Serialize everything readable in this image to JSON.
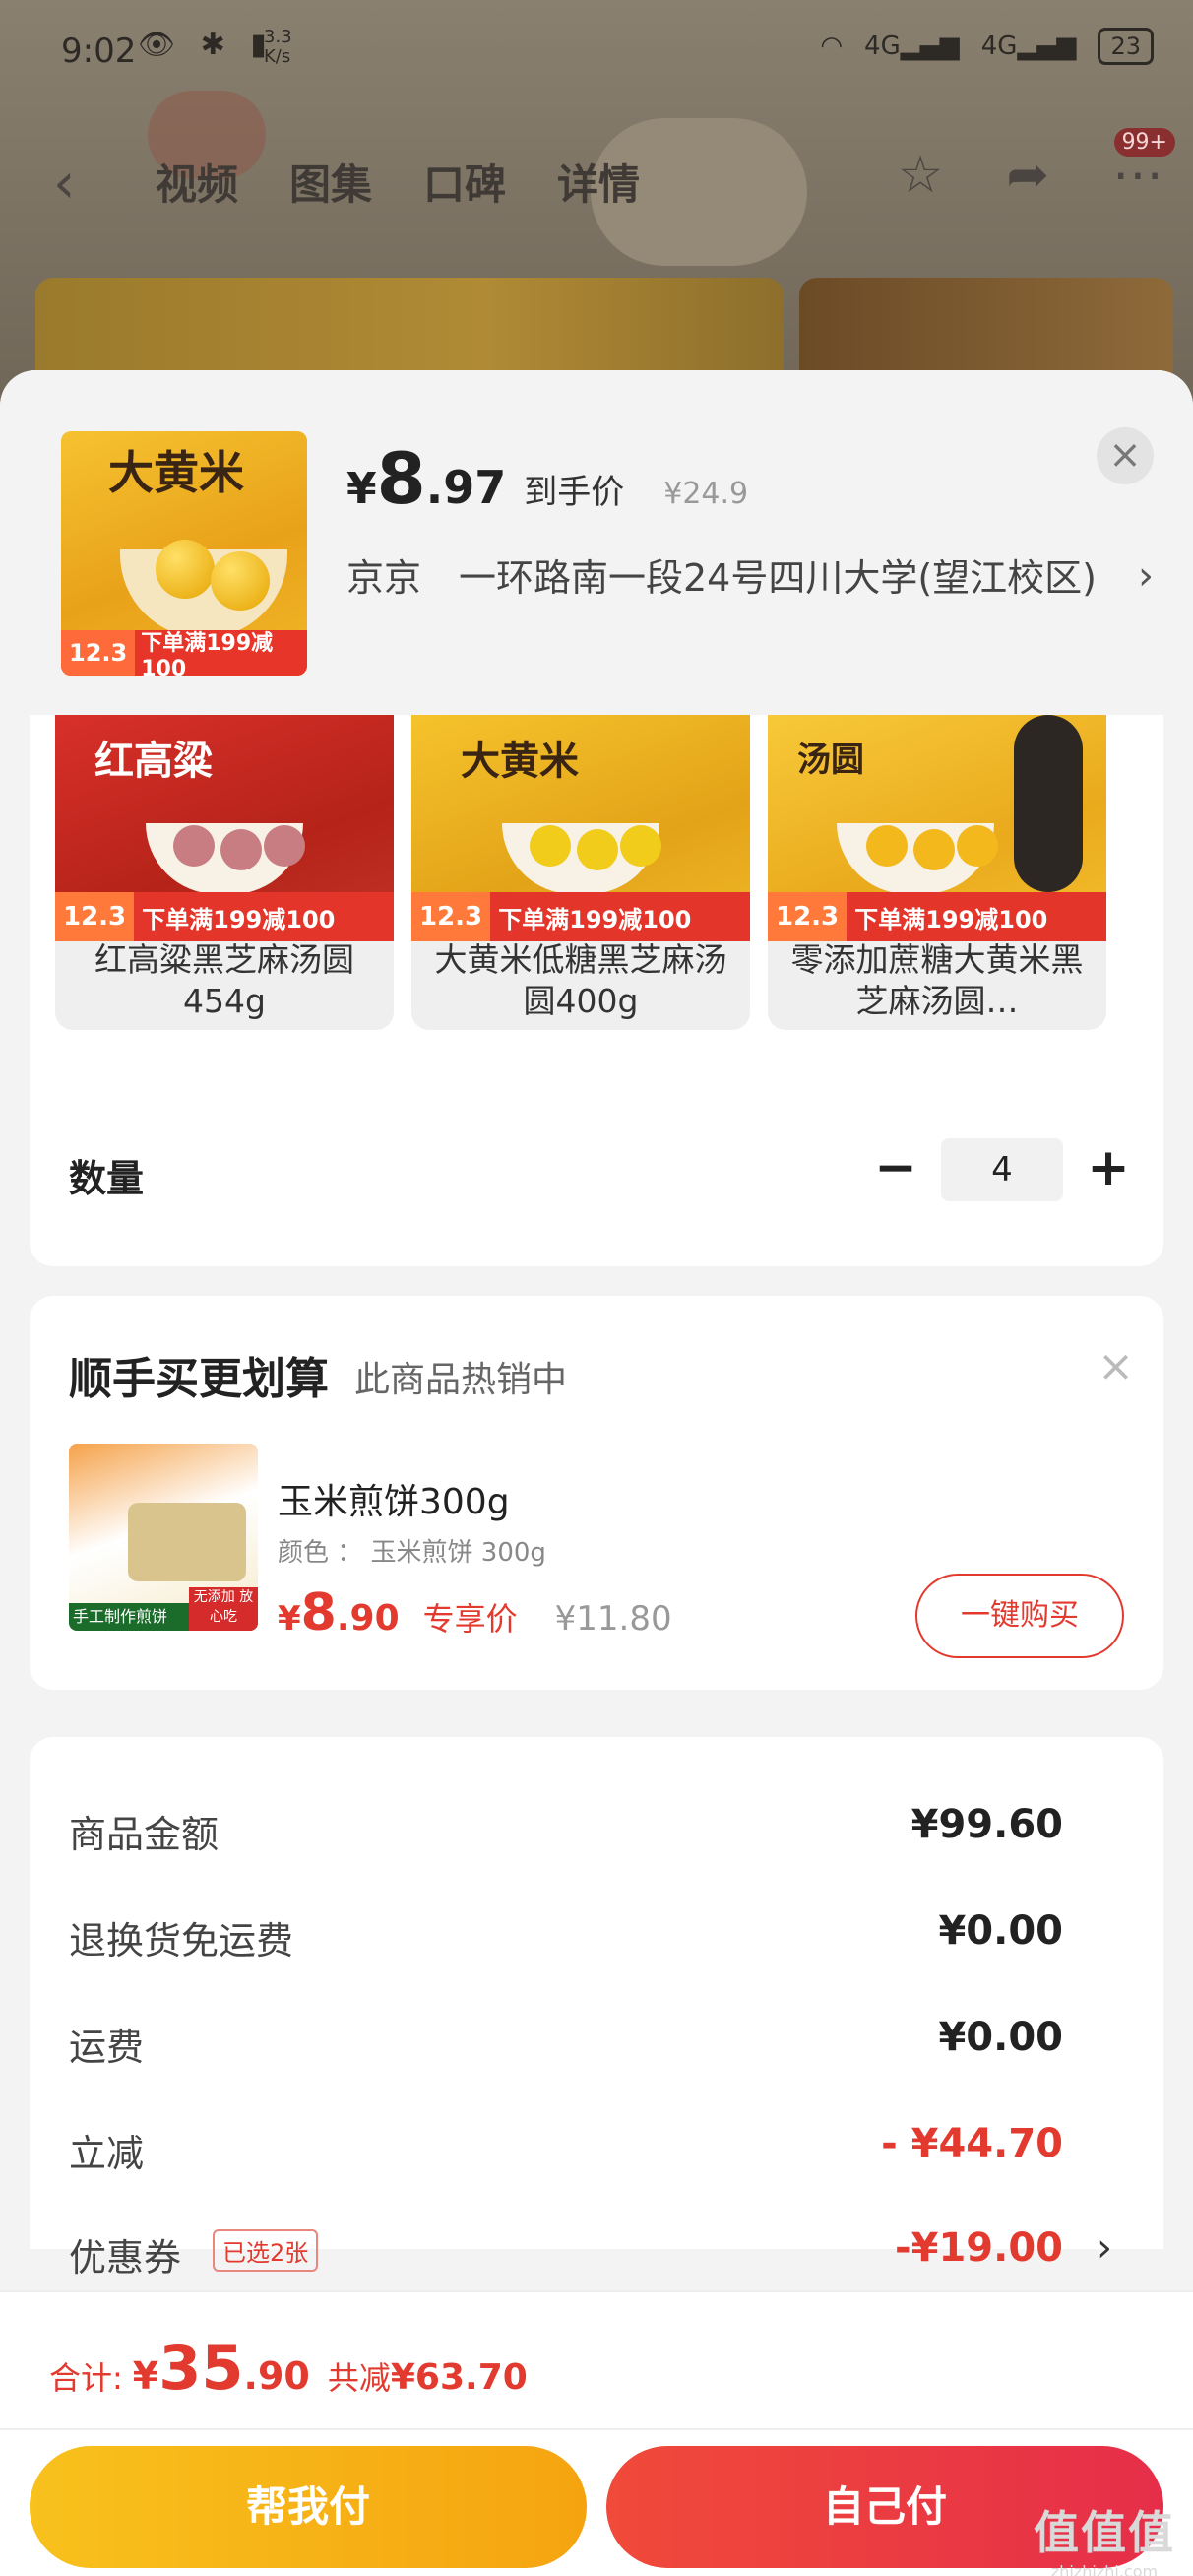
{
  "status_bar": {
    "time": "9:02",
    "speed": "3.3\nK/s",
    "battery": "23",
    "network1": "4G",
    "network2": "4G"
  },
  "top_nav": {
    "tabs": [
      "视频",
      "图集",
      "口碑",
      "详情"
    ],
    "badge": "99+"
  },
  "product": {
    "price_currency": "¥",
    "price_int": "8",
    "price_dec": ".97",
    "price_label": "到手价",
    "original_price": "¥24.9",
    "address": "京京　一环路南一段24号四川大学(望江校区)",
    "thumb_title": "大黄米",
    "thumb_price": "12.3",
    "thumb_promo": "下单满199减100"
  },
  "variants": [
    {
      "label": "红高粱黑芝麻汤圆454g",
      "title": "红高粱",
      "promo_price": "12.3",
      "promo_text": "下单满199减100"
    },
    {
      "label": "大黄米低糖黑芝麻汤圆400g",
      "title": "大黄米",
      "promo_price": "12.3",
      "promo_text": "下单满199减100"
    },
    {
      "label": "零添加蔗糖大黄米黑芝麻汤圆…",
      "title": "汤圆",
      "promo_price": "12.3",
      "promo_text": "下单满199减100"
    }
  ],
  "quantity": {
    "label": "数量",
    "minus": "−",
    "value": "4",
    "plus": "+"
  },
  "addon": {
    "title": "顺手买更划算",
    "subtitle": "此商品热销中",
    "close": "×",
    "name": "玉米煎饼300g",
    "color_line": "颜色 ： 玉米煎饼 300g",
    "price_currency": "¥",
    "price_int": "8",
    "price_dec": ".90",
    "price_tag": "专享价",
    "old_price": "¥11.80",
    "buy_button": "一键购买",
    "img_strip": "手工制作煎饼",
    "img_strip2": "无添加 放心吃"
  },
  "fees": {
    "goods_label": "商品金额",
    "goods_value": "¥99.60",
    "return_label": "退换货免运费",
    "return_value": "¥0.00",
    "shipping_label": "运费",
    "shipping_value": "¥0.00",
    "discount_label": "立减",
    "discount_value": "- ¥44.70",
    "coupon_label": "优惠券",
    "coupon_tag": "已选2张",
    "coupon_value": "-¥19.00"
  },
  "bottom": {
    "total_label": "合计:",
    "total_currency": "¥",
    "total_int": "35",
    "total_dec": ".90",
    "save_label": "共减",
    "save_amount": "¥63.70",
    "help_pay": "帮我付",
    "self_pay": "自己付",
    "watermark": "值值值",
    "watermark_url": "zhizhizhi.com"
  },
  "colors": {
    "accent_red": "#e33a2f",
    "yellow_button": "#f8c11c",
    "red_button": "#f04a3a"
  }
}
